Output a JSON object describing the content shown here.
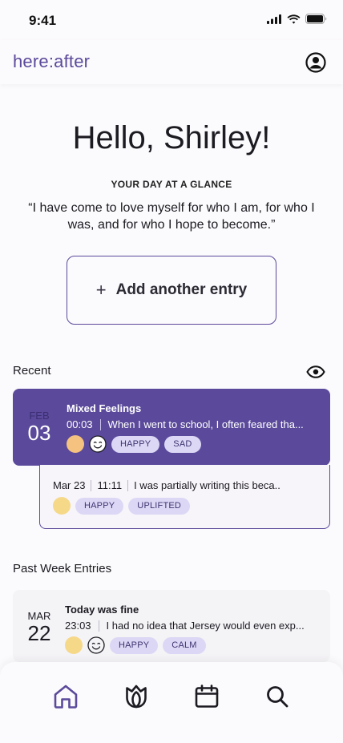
{
  "status": {
    "time": "9:41"
  },
  "header": {
    "brand": "here:after"
  },
  "greeting": "Hello, Shirley!",
  "glance": {
    "label": "YOUR DAY AT A GLANCE",
    "quote": "“I have come to love myself for who I am, for who I was, and for who I hope to become.”"
  },
  "add_entry": {
    "plus": "+",
    "label": "Add another entry"
  },
  "recent": {
    "title": "Recent",
    "entry": {
      "month": "FEB",
      "day": "03",
      "title": "Mixed Feelings",
      "time": "00:03",
      "snippet": "When I went to school, I often feared tha...",
      "dot_color": "#f6c27f",
      "tags": [
        "HAPPY",
        "SAD"
      ]
    },
    "sub_entry": {
      "date": "Mar 23",
      "time": "11:11",
      "snippet": "I was partially writing this beca..",
      "dot_color": "#f6d889",
      "tags": [
        "HAPPY",
        "UPLIFTED"
      ]
    }
  },
  "past_week": {
    "title": "Past Week Entries",
    "entry": {
      "month": "MAR",
      "day": "22",
      "title": "Today was fine",
      "time": "23:03",
      "snippet": "I had no idea that Jersey would even exp...",
      "dot_color": "#f6d889",
      "tags": [
        "HAPPY",
        "CALM"
      ]
    }
  },
  "nav": {
    "items": [
      "home-icon",
      "lotus-icon",
      "calendar-icon",
      "search-icon"
    ],
    "active_color": "#5b4a9b",
    "inactive_color": "#1c1b21"
  },
  "colors": {
    "accent": "#5b4a9b",
    "tag_bg": "#dcd7f5",
    "card_bg": "#f4f3f6"
  }
}
